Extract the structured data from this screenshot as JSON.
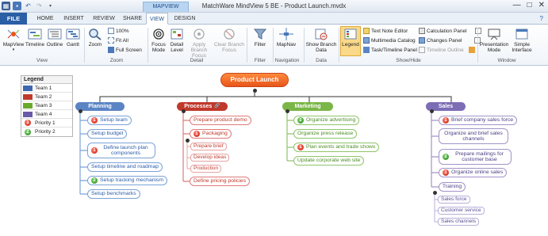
{
  "window": {
    "title": "MatchWare MindView 5 BE - Product Launch.mvdx",
    "context_tab": "MAPVIEW",
    "controls": [
      "—",
      "□",
      "✕"
    ]
  },
  "tabs": {
    "file": "FILE",
    "items": [
      "HOME",
      "INSERT",
      "REVIEW",
      "SHARE",
      "VIEW",
      "DESIGN"
    ],
    "active": "VIEW",
    "help": "?"
  },
  "ribbon": {
    "view": {
      "label": "View",
      "mapview": "MapView",
      "timeline": "Timeline",
      "outline": "Outline",
      "gantt": "Gantt"
    },
    "zoom": {
      "label": "Zoom",
      "zoom": "Zoom",
      "percent": "100%",
      "fit_all": "Fit All",
      "full_screen": "Full Screen"
    },
    "detail": {
      "label": "Detail",
      "focus_mode": "Focus Mode",
      "detail_level": "Detail Level",
      "apply_branch_focus": "Apply Branch Focus",
      "clear_branch_focus": "Clear Branch Focus"
    },
    "filter": {
      "label": "Filter",
      "filter": "Filter"
    },
    "navigation": {
      "label": "Navigation",
      "mapnav": "MapNav"
    },
    "data": {
      "label": "Data",
      "show_branch_data": "Show Branch Data"
    },
    "show_hide": {
      "label": "Show/Hide",
      "legend": "Legend",
      "text_note_editor": "Text Note Editor",
      "multimedia_catalog": "Multimedia Catalog",
      "task_timeline_panel": "Task/Timeline Panel",
      "calculation_panel": "Calculation Panel",
      "changes_panel": "Changes Panel",
      "timeline_outline": "Timeline Outline"
    },
    "window": {
      "label": "Window",
      "presentation_mode": "Presentation Mode",
      "simple_interface": "Simple Interface"
    }
  },
  "legend": {
    "title": "Legend",
    "teams": [
      {
        "label": "Team 1",
        "color": "#3f67b1"
      },
      {
        "label": "Team 2",
        "color": "#c0392b"
      },
      {
        "label": "Team 3",
        "color": "#6aaa2a"
      },
      {
        "label": "Team 4",
        "color": "#6a5aa8"
      }
    ],
    "priorities": [
      {
        "label": "Priority 1",
        "num": "1",
        "color": "#d9281a"
      },
      {
        "label": "Priority 2",
        "num": "2",
        "color": "#3a9a28"
      }
    ]
  },
  "map": {
    "central": "Product Launch",
    "branches": {
      "planning": {
        "label": "Planning",
        "color": "#5b84c4",
        "items": [
          "Setup team",
          "Setup budget",
          "Define launch plan components",
          "Setup timeline and roadmap",
          "Setup tracking mechanism",
          "Setup benchmarks"
        ]
      },
      "processes": {
        "label": "Processes",
        "color": "#c0392b",
        "items": [
          "Prepare product demo",
          "Packaging",
          "Define pricing policies"
        ],
        "packaging_children": [
          "Prepare brief",
          "Develop ideas",
          "Production"
        ]
      },
      "marketing": {
        "label": "Marketing",
        "color": "#7ab648",
        "items": [
          "Organize advertising",
          "Organize press release",
          "Plan events and trade shows",
          "Update corporate web site"
        ]
      },
      "sales": {
        "label": "Sales",
        "color": "#7d6db5",
        "items": [
          "Brief company sales force",
          "Organize and brief sales channels",
          "Prepare mailings for customer base",
          "Organize online sales",
          "Training"
        ],
        "training_children": [
          "Sales force",
          "Customer service",
          "Sales channels"
        ]
      }
    }
  }
}
